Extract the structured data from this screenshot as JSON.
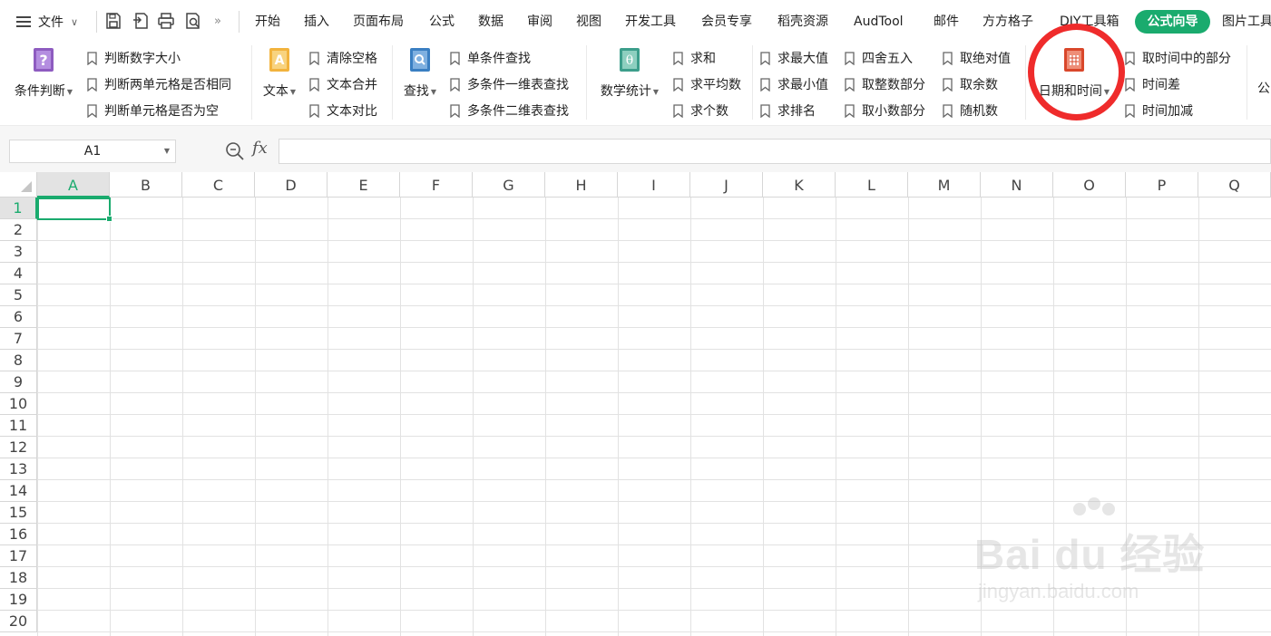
{
  "menu": {
    "file_label": "文件",
    "tabs": [
      "开始",
      "插入",
      "页面布局",
      "公式",
      "数据",
      "审阅",
      "视图",
      "开发工具",
      "会员专享",
      "稻壳资源",
      "AudTool",
      "邮件",
      "方方格子",
      "DIY工具箱"
    ],
    "active_tab": "公式向导",
    "overflow_tab": "图片工具"
  },
  "ribbon": {
    "cond_label": "条件判断",
    "cond_items": [
      "判断数字大小",
      "判断两单元格是否相同",
      "判断单元格是否为空"
    ],
    "text_label": "文本",
    "text_items": [
      "清除空格",
      "文本合并",
      "文本对比"
    ],
    "find_label": "查找",
    "find_items": [
      "单条件查找",
      "多条件一维表查找",
      "多条件二维表查找"
    ],
    "math_label": "数学统计",
    "math_col1": [
      "求和",
      "求平均数",
      "求个数"
    ],
    "math_col2": [
      "求最大值",
      "求最小值",
      "求排名"
    ],
    "math_col3": [
      "四舍五入",
      "取整数部分",
      "取小数部分"
    ],
    "math_col4": [
      "取绝对值",
      "取余数",
      "随机数"
    ],
    "date_label": "日期和时间",
    "date_items": [
      "取时间中的部分",
      "时间差",
      "时间加减"
    ],
    "overflow": "公"
  },
  "formula_bar": {
    "name_box": "A1",
    "fx": "fx",
    "value": ""
  },
  "grid": {
    "columns": [
      "A",
      "B",
      "C",
      "D",
      "E",
      "F",
      "G",
      "H",
      "I",
      "J",
      "K",
      "L",
      "M",
      "N",
      "O",
      "P",
      "Q"
    ],
    "rows": [
      "1",
      "2",
      "3",
      "4",
      "5",
      "6",
      "7",
      "8",
      "9",
      "10",
      "11",
      "12",
      "13",
      "14",
      "15",
      "16",
      "17",
      "18",
      "19",
      "20"
    ],
    "active_cell": "A1"
  },
  "colors": {
    "accent": "#1aab6e",
    "highlight_circle": "#ef2b2b"
  },
  "watermark": {
    "main": "Bai du 经验",
    "sub": "jingyan.baidu.com"
  }
}
